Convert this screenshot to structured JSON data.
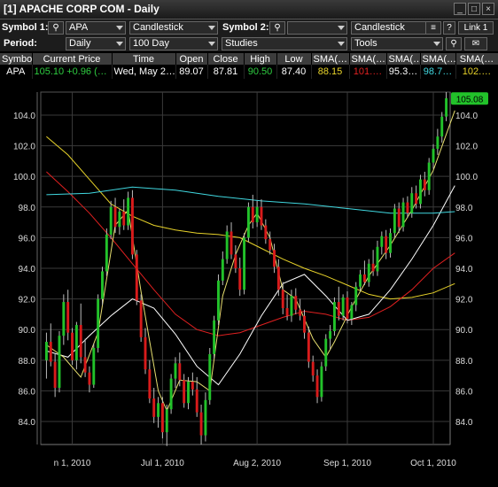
{
  "window": {
    "title": "[1] APACHE CORP COM - Daily",
    "min_icon": "minimize-icon",
    "max_icon": "maximize-icon",
    "close_icon": "close-icon"
  },
  "toolbar1": {
    "symbol1_label": "Symbol 1:",
    "symbol1_value": "APA",
    "chart_type1": "Candlestick",
    "symbol2_label": "Symbol 2:",
    "symbol2_value": "",
    "chart_type2": "Candlestick",
    "help": "?",
    "link": "Link 1"
  },
  "toolbar2": {
    "period_label": "Period:",
    "period_value": "Daily",
    "range_value": "100 Day",
    "studies_value": "Studies",
    "tools_value": "Tools"
  },
  "quote": {
    "headers": [
      "Symbol",
      "Current Price",
      "Time",
      "Open",
      "Close",
      "High",
      "Low",
      "SMA(…",
      "SMA(…",
      "SMA(…",
      "SMA(…",
      "SMA(…"
    ],
    "row": [
      "APA",
      "105.10",
      "+0.96 (…",
      "Wed, May 2…",
      "89.07",
      "87.81",
      "90.50",
      "87.40",
      "88.15",
      "101.…",
      "95.3…",
      "98.7…",
      "102.…"
    ],
    "colors": {
      "price": "#2ecc40",
      "change": "#2ecc40",
      "high": "#2ecc40",
      "low": "#ffffff",
      "sma1": "#e8d32a",
      "sma2": "#e02020",
      "sma3": "#ffffff",
      "sma4": "#40d8e0",
      "sma5": "#e8d32a"
    }
  },
  "chart_data": {
    "type": "candlestick",
    "ylim": [
      82.5,
      105.5
    ],
    "y_ticks": [
      "104.0",
      "102.0",
      "100.0",
      "98.0",
      "96.0",
      "94.0",
      "92.0",
      "90.0",
      "88.0",
      "86.0",
      "84.0"
    ],
    "x_tick_labels": [
      "n 1, 2010",
      "Jul 1, 2010",
      "Aug 2, 2010",
      "Sep 1, 2010",
      "Oct 1, 2010"
    ],
    "x_tick_positions": [
      6,
      27,
      49,
      70,
      90
    ],
    "last_price": "105.08",
    "up_color": "#22c22a",
    "down_color": "#d81b1b",
    "candles": [
      [
        88.0,
        89.8,
        86.8,
        89.2
      ],
      [
        89.2,
        90.4,
        87.6,
        87.9
      ],
      [
        87.9,
        88.4,
        85.6,
        86.2
      ],
      [
        86.2,
        89.9,
        85.9,
        89.6
      ],
      [
        89.6,
        92.3,
        89.0,
        91.8
      ],
      [
        91.8,
        92.6,
        89.3,
        89.8
      ],
      [
        89.8,
        90.1,
        87.7,
        88.0
      ],
      [
        88.0,
        90.5,
        87.4,
        90.3
      ],
      [
        90.3,
        91.7,
        87.8,
        88.2
      ],
      [
        88.2,
        89.4,
        86.9,
        87.2
      ],
      [
        87.2,
        87.6,
        85.9,
        86.4
      ],
      [
        86.4,
        89.1,
        86.2,
        88.8
      ],
      [
        88.8,
        92.3,
        88.5,
        92.0
      ],
      [
        92.0,
        94.1,
        91.6,
        93.8
      ],
      [
        93.8,
        96.6,
        93.5,
        96.2
      ],
      [
        96.2,
        98.4,
        95.9,
        98.0
      ],
      [
        98.0,
        98.6,
        96.3,
        96.7
      ],
      [
        96.7,
        97.9,
        96.2,
        97.7
      ],
      [
        97.7,
        98.5,
        96.5,
        96.8
      ],
      [
        96.8,
        99.0,
        96.5,
        98.6
      ],
      [
        98.6,
        99.1,
        94.6,
        94.9
      ],
      [
        94.9,
        95.2,
        91.6,
        91.9
      ],
      [
        91.9,
        92.3,
        89.2,
        89.5
      ],
      [
        89.5,
        90.1,
        87.1,
        87.4
      ],
      [
        87.4,
        88.0,
        85.2,
        85.5
      ],
      [
        85.5,
        86.2,
        83.9,
        84.3
      ],
      [
        84.3,
        85.6,
        83.6,
        85.2
      ],
      [
        85.2,
        85.6,
        82.9,
        83.3
      ],
      [
        83.3,
        85.1,
        82.4,
        84.8
      ],
      [
        84.8,
        87.1,
        84.5,
        86.8
      ],
      [
        86.8,
        88.2,
        86.2,
        87.8
      ],
      [
        87.8,
        88.5,
        86.3,
        86.7
      ],
      [
        86.7,
        87.1,
        84.9,
        85.2
      ],
      [
        85.2,
        86.9,
        84.8,
        86.6
      ],
      [
        86.6,
        87.2,
        85.7,
        86.1
      ],
      [
        86.1,
        86.9,
        84.3,
        84.6
      ],
      [
        84.6,
        85.1,
        82.5,
        83.1
      ],
      [
        83.1,
        85.9,
        82.7,
        85.4
      ],
      [
        85.4,
        88.8,
        85.1,
        88.4
      ],
      [
        88.4,
        90.9,
        88.1,
        90.6
      ],
      [
        90.6,
        93.6,
        90.3,
        93.2
      ],
      [
        93.2,
        95.1,
        92.9,
        94.6
      ],
      [
        94.6,
        96.8,
        94.3,
        96.4
      ],
      [
        96.4,
        97.0,
        94.6,
        94.9
      ],
      [
        94.9,
        95.5,
        93.7,
        94.0
      ],
      [
        94.0,
        94.7,
        92.2,
        92.6
      ],
      [
        92.6,
        96.3,
        92.3,
        96.0
      ],
      [
        96.0,
        98.3,
        95.7,
        98.0
      ],
      [
        98.0,
        98.8,
        96.6,
        97.0
      ],
      [
        97.0,
        98.4,
        96.7,
        98.0
      ],
      [
        98.0,
        98.5,
        96.5,
        96.8
      ],
      [
        96.8,
        97.2,
        95.6,
        95.9
      ],
      [
        95.9,
        96.4,
        94.9,
        95.2
      ],
      [
        95.2,
        95.6,
        93.7,
        94.1
      ],
      [
        94.1,
        94.6,
        92.2,
        92.6
      ],
      [
        92.6,
        93.1,
        91.0,
        91.4
      ],
      [
        91.4,
        92.3,
        90.6,
        90.9
      ],
      [
        90.9,
        92.6,
        90.5,
        92.2
      ],
      [
        92.2,
        92.7,
        91.0,
        91.3
      ],
      [
        91.3,
        92.0,
        90.6,
        90.9
      ],
      [
        90.9,
        91.3,
        89.4,
        89.8
      ],
      [
        89.8,
        90.2,
        87.5,
        87.9
      ],
      [
        87.9,
        88.3,
        86.6,
        87.0
      ],
      [
        87.0,
        87.4,
        85.2,
        85.6
      ],
      [
        85.6,
        87.9,
        85.3,
        87.6
      ],
      [
        87.6,
        89.7,
        87.3,
        89.4
      ],
      [
        89.4,
        90.3,
        88.7,
        89.9
      ],
      [
        89.9,
        92.1,
        89.6,
        91.8
      ],
      [
        91.8,
        92.8,
        90.6,
        90.9
      ],
      [
        90.9,
        92.3,
        90.6,
        92.1
      ],
      [
        92.1,
        92.5,
        90.4,
        90.7
      ],
      [
        90.7,
        91.8,
        90.3,
        91.6
      ],
      [
        91.6,
        93.1,
        91.2,
        92.8
      ],
      [
        92.8,
        93.9,
        92.5,
        93.6
      ],
      [
        93.6,
        94.5,
        92.9,
        93.1
      ],
      [
        93.1,
        94.6,
        92.8,
        94.3
      ],
      [
        94.3,
        95.2,
        93.5,
        93.8
      ],
      [
        93.8,
        95.8,
        93.5,
        95.4
      ],
      [
        95.4,
        96.4,
        94.9,
        96.1
      ],
      [
        96.1,
        96.5,
        94.6,
        95.0
      ],
      [
        95.0,
        96.6,
        94.7,
        96.3
      ],
      [
        96.3,
        98.2,
        96.0,
        97.9
      ],
      [
        97.9,
        98.3,
        96.3,
        96.7
      ],
      [
        96.7,
        98.6,
        96.4,
        98.3
      ],
      [
        98.3,
        98.7,
        97.3,
        97.6
      ],
      [
        97.6,
        99.3,
        97.3,
        98.9
      ],
      [
        98.9,
        99.4,
        97.9,
        98.2
      ],
      [
        98.2,
        100.1,
        97.9,
        99.8
      ],
      [
        99.8,
        100.3,
        98.7,
        99.1
      ],
      [
        99.1,
        101.2,
        98.8,
        100.9
      ],
      [
        100.9,
        102.1,
        100.5,
        101.8
      ],
      [
        101.8,
        103.1,
        101.4,
        102.6
      ],
      [
        102.6,
        104.2,
        102.2,
        103.9
      ],
      [
        103.9,
        105.5,
        103.6,
        105.1
      ]
    ],
    "series": [
      {
        "color": "#e8d32a",
        "points": [
          [
            0,
            102.6
          ],
          [
            5,
            101.4
          ],
          [
            10,
            99.8
          ],
          [
            15,
            98.2
          ],
          [
            20,
            97.4
          ],
          [
            25,
            96.8
          ],
          [
            30,
            96.5
          ],
          [
            35,
            96.3
          ],
          [
            40,
            96.2
          ],
          [
            45,
            96.0
          ],
          [
            50,
            95.3
          ],
          [
            55,
            94.6
          ],
          [
            60,
            94.0
          ],
          [
            65,
            93.5
          ],
          [
            70,
            92.9
          ],
          [
            75,
            92.3
          ],
          [
            80,
            92.0
          ],
          [
            85,
            92.1
          ],
          [
            90,
            92.4
          ],
          [
            95,
            93.0
          ]
        ]
      },
      {
        "color": "#e02020",
        "points": [
          [
            0,
            100.3
          ],
          [
            5,
            99.0
          ],
          [
            10,
            97.6
          ],
          [
            15,
            96.0
          ],
          [
            20,
            94.3
          ],
          [
            25,
            92.6
          ],
          [
            30,
            91.0
          ],
          [
            35,
            90.0
          ],
          [
            40,
            89.6
          ],
          [
            45,
            89.8
          ],
          [
            50,
            90.3
          ],
          [
            55,
            90.8
          ],
          [
            60,
            91.2
          ],
          [
            65,
            91.0
          ],
          [
            70,
            90.6
          ],
          [
            75,
            90.8
          ],
          [
            80,
            91.5
          ],
          [
            85,
            92.6
          ],
          [
            90,
            94.0
          ],
          [
            95,
            95.0
          ]
        ]
      },
      {
        "color": "#ffffff",
        "points": [
          [
            0,
            88.6
          ],
          [
            5,
            88.2
          ],
          [
            10,
            89.6
          ],
          [
            15,
            90.9
          ],
          [
            20,
            92.0
          ],
          [
            25,
            91.4
          ],
          [
            30,
            89.7
          ],
          [
            35,
            87.6
          ],
          [
            40,
            86.4
          ],
          [
            45,
            88.4
          ],
          [
            50,
            90.9
          ],
          [
            55,
            93.0
          ],
          [
            60,
            93.6
          ],
          [
            65,
            92.2
          ],
          [
            70,
            90.6
          ],
          [
            75,
            91.0
          ],
          [
            80,
            92.6
          ],
          [
            85,
            94.6
          ],
          [
            90,
            96.8
          ],
          [
            95,
            99.4
          ]
        ]
      },
      {
        "color": "#40d8e0",
        "points": [
          [
            0,
            98.8
          ],
          [
            10,
            98.9
          ],
          [
            20,
            99.3
          ],
          [
            30,
            99.1
          ],
          [
            40,
            98.7
          ],
          [
            50,
            98.4
          ],
          [
            60,
            98.2
          ],
          [
            70,
            97.9
          ],
          [
            80,
            97.6
          ],
          [
            90,
            97.6
          ],
          [
            95,
            97.7
          ]
        ]
      },
      {
        "color": "#e8e070",
        "points": [
          [
            0,
            89.0
          ],
          [
            4,
            88.2
          ],
          [
            8,
            86.9
          ],
          [
            12,
            89.8
          ],
          [
            16,
            96.8
          ],
          [
            19,
            97.8
          ],
          [
            22,
            92.5
          ],
          [
            26,
            86.0
          ],
          [
            28,
            84.7
          ],
          [
            31,
            86.7
          ],
          [
            35,
            86.6
          ],
          [
            38,
            86.0
          ],
          [
            41,
            92.2
          ],
          [
            44,
            94.9
          ],
          [
            47,
            96.8
          ],
          [
            49,
            97.6
          ],
          [
            52,
            96.0
          ],
          [
            55,
            92.6
          ],
          [
            58,
            92.0
          ],
          [
            62,
            89.4
          ],
          [
            65,
            88.2
          ],
          [
            67,
            89.2
          ],
          [
            71,
            91.5
          ],
          [
            75,
            93.5
          ],
          [
            80,
            95.5
          ],
          [
            85,
            97.8
          ],
          [
            90,
            100.4
          ],
          [
            95,
            104.3
          ]
        ]
      }
    ]
  }
}
